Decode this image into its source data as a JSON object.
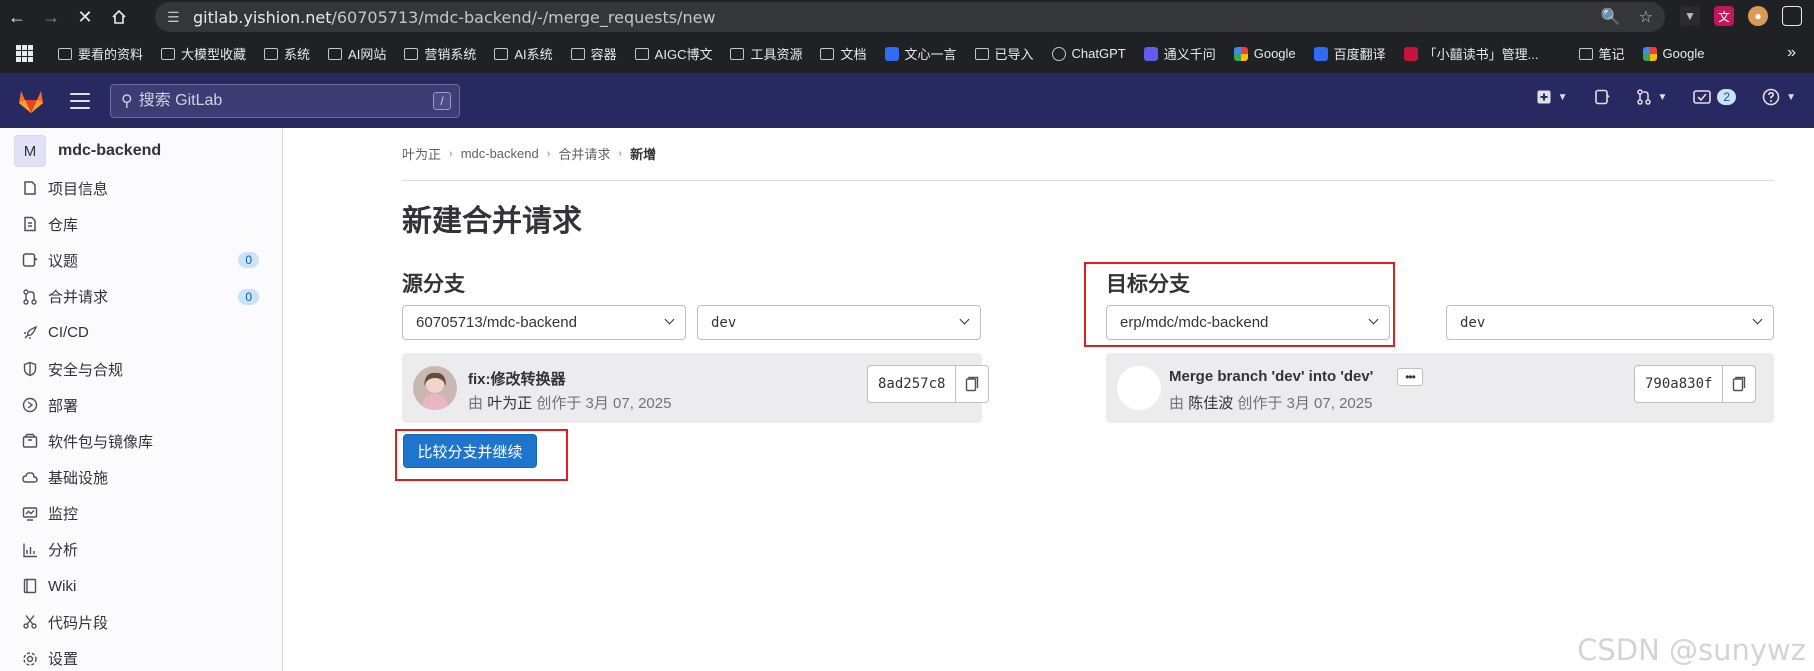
{
  "browser": {
    "url_host": "gitlab.yishion.net",
    "url_path": "/60705713/mdc-backend/-/merge_requests/new",
    "bookmarks": [
      {
        "label": "要看的资料",
        "icon": "folder-icon"
      },
      {
        "label": "大模型收藏",
        "icon": "folder-icon"
      },
      {
        "label": "系统",
        "icon": "folder-icon"
      },
      {
        "label": "AI网站",
        "icon": "folder-icon"
      },
      {
        "label": "营销系统",
        "icon": "folder-icon"
      },
      {
        "label": "AI系统",
        "icon": "folder-icon"
      },
      {
        "label": "容器",
        "icon": "folder-icon"
      },
      {
        "label": "AIGC博文",
        "icon": "folder-icon"
      },
      {
        "label": "工具资源",
        "icon": "folder-icon"
      },
      {
        "label": "文档",
        "icon": "folder-icon"
      },
      {
        "label": "文心一言",
        "icon": "wenxin-icon"
      },
      {
        "label": "已导入",
        "icon": "folder-icon"
      },
      {
        "label": "ChatGPT",
        "icon": "chatgpt-icon"
      },
      {
        "label": "通义千问",
        "icon": "tongyi-icon"
      },
      {
        "label": "Google",
        "icon": "google-icon"
      },
      {
        "label": "百度翻译",
        "icon": "baidu-translate-icon"
      },
      {
        "label": "「小囍读书」管理...",
        "icon": "xiaoxi-icon"
      },
      {
        "label": "笔记",
        "icon": "folder-icon"
      },
      {
        "label": "Google",
        "icon": "google-icon"
      }
    ]
  },
  "header": {
    "search_placeholder": "搜索 GitLab",
    "search_shortcut": "/",
    "todo_count": "2",
    "brand_color": "#292961"
  },
  "sidebar": {
    "project_avatar": "M",
    "project_name": "mdc-backend",
    "items": [
      {
        "label": "项目信息",
        "icon": "project-info-icon"
      },
      {
        "label": "仓库",
        "icon": "repository-icon"
      },
      {
        "label": "议题",
        "icon": "issues-icon",
        "badge": "0"
      },
      {
        "label": "合并请求",
        "icon": "merge-request-icon",
        "badge": "0"
      },
      {
        "label": "CI/CD",
        "icon": "rocket-icon"
      },
      {
        "label": "安全与合规",
        "icon": "shield-icon"
      },
      {
        "label": "部署",
        "icon": "deployments-icon"
      },
      {
        "label": "软件包与镜像库",
        "icon": "package-icon"
      },
      {
        "label": "基础设施",
        "icon": "cloud-gear-icon"
      },
      {
        "label": "监控",
        "icon": "monitor-icon"
      },
      {
        "label": "分析",
        "icon": "chart-icon"
      },
      {
        "label": "Wiki",
        "icon": "book-icon"
      },
      {
        "label": "代码片段",
        "icon": "snippet-icon"
      },
      {
        "label": "设置",
        "icon": "settings-icon"
      }
    ]
  },
  "breadcrumb": [
    "叶为正",
    "mdc-backend",
    "合并请求",
    "新增"
  ],
  "page": {
    "title": "新建合并请求",
    "source": {
      "heading": "源分支",
      "project": "60705713/mdc-backend",
      "branch": "dev",
      "commit": {
        "title": "fix:修改转换器",
        "by": "由",
        "author": "叶为正",
        "created": "创作于 3月 07, 2025",
        "sha": "8ad257c8"
      }
    },
    "target": {
      "heading": "目标分支",
      "project": "erp/mdc/mdc-backend",
      "branch": "dev",
      "commit": {
        "title": "Merge branch 'dev' into 'dev'",
        "by": "由",
        "author": "陈佳波",
        "created": "创作于 3月 07, 2025",
        "sha": "790a830f",
        "more": "•••"
      }
    },
    "compare_button": "比较分支并继续",
    "primary_color": "#1f75cb",
    "highlight_color": "#e02020"
  },
  "watermark": "CSDN @sunywz"
}
